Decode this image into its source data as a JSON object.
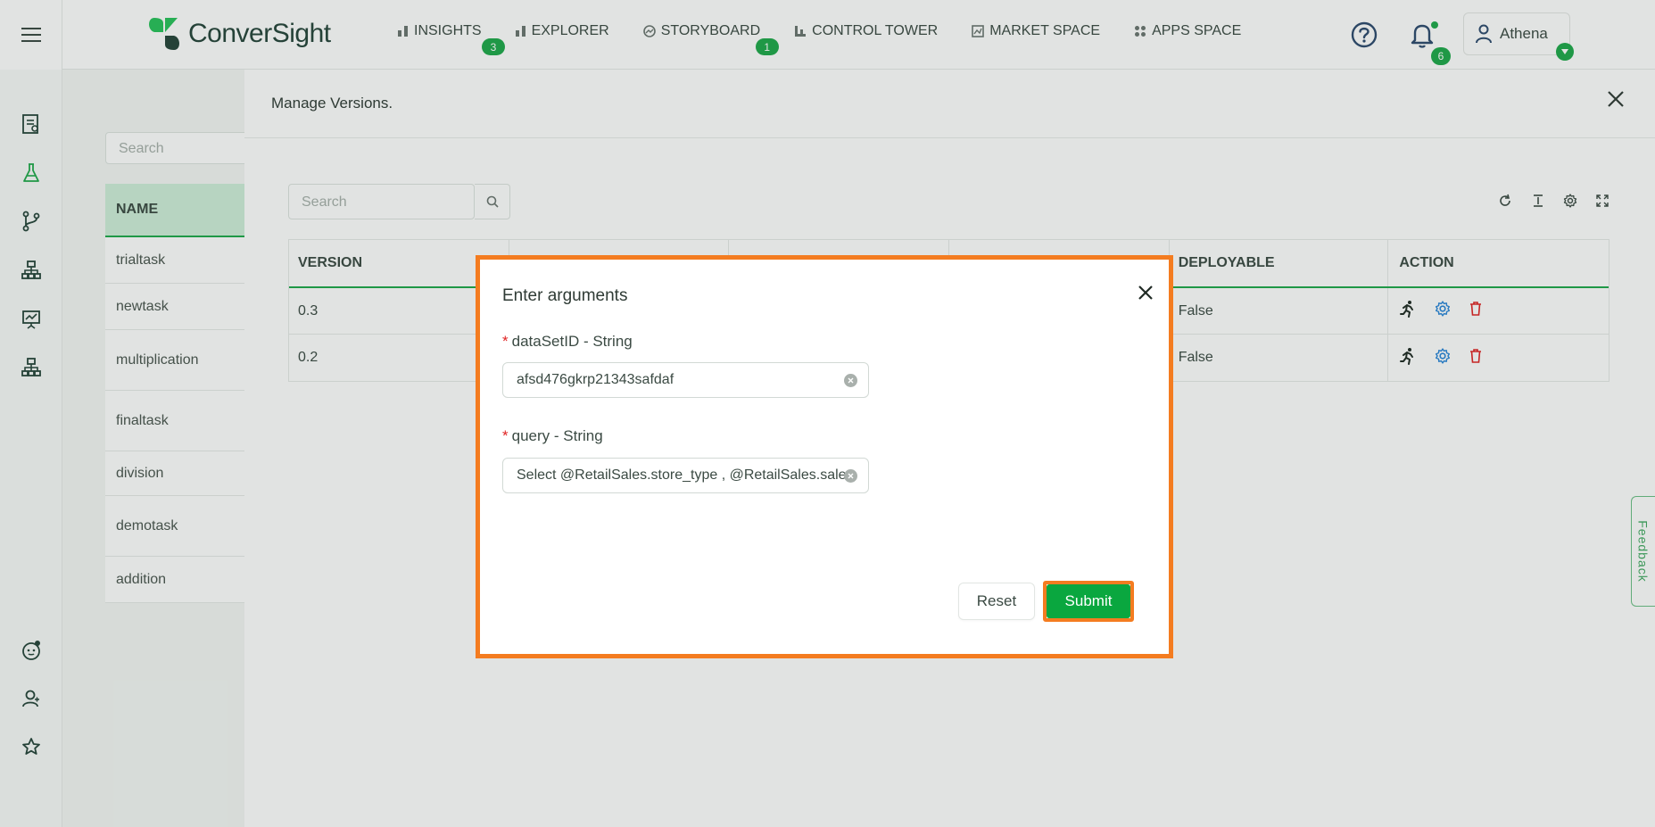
{
  "app": {
    "logo_text": "ConverSight",
    "brand_color": "#1ea84a"
  },
  "nav": [
    {
      "label": "INSIGHTS",
      "icon": "bar-chart-icon",
      "badge": "3"
    },
    {
      "label": "EXPLORER",
      "icon": "bar-chart-icon",
      "badge": ""
    },
    {
      "label": "STORYBOARD",
      "icon": "storyboard-icon",
      "badge": "1"
    },
    {
      "label": "CONTROL TOWER",
      "icon": "control-tower-icon",
      "badge": ""
    },
    {
      "label": "MARKET SPACE",
      "icon": "market-space-icon",
      "badge": ""
    },
    {
      "label": "APPS SPACE",
      "icon": "apps-grid-icon",
      "badge": ""
    }
  ],
  "header": {
    "notification_count": "6",
    "user_name": "Athena"
  },
  "sidebar_icons": [
    "reports-icon",
    "flask-icon",
    "branch-icon",
    "hierarchy-icon",
    "presentation-icon",
    "hierarchy-icon",
    "bot-icon",
    "users-icon",
    "star-icon"
  ],
  "background_list": {
    "search_placeholder": "Search",
    "column": "NAME",
    "items": [
      "trialtask",
      "newtask",
      "multiplication",
      "finaltask",
      "division",
      "demotask",
      "addition"
    ]
  },
  "drawer": {
    "title": "Manage Versions.",
    "search_placeholder": "Search",
    "columns": {
      "version": "VERSION",
      "deployable": "DEPLOYABLE",
      "action": "ACTION"
    },
    "rows": [
      {
        "version": "0.3",
        "deployable": "False"
      },
      {
        "version": "0.2",
        "deployable": "False"
      }
    ]
  },
  "modal": {
    "title": "Enter arguments",
    "fields": [
      {
        "label": "dataSetID - String",
        "value": "afsd476gkrp21343safdaf"
      },
      {
        "label": "query - String",
        "value": "Select @RetailSales.store_type , @RetailSales.sales"
      }
    ],
    "reset_label": "Reset",
    "submit_label": "Submit",
    "highlight_color": "#f47c20"
  },
  "feedback_label": "Feedback"
}
